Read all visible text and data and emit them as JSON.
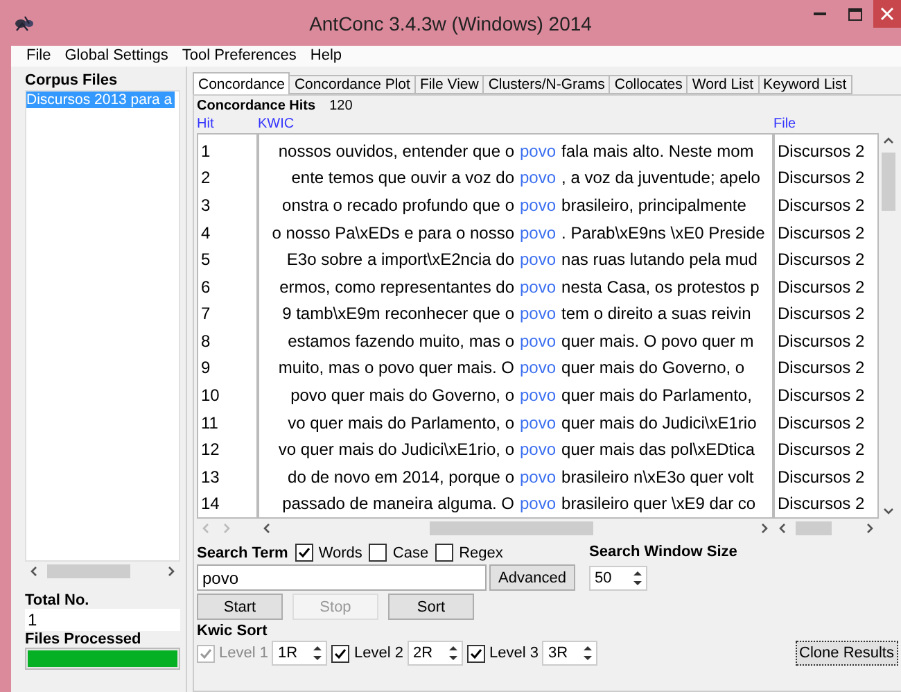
{
  "window": {
    "title": "AntConc 3.4.3w (Windows) 2014"
  },
  "menu": [
    "File",
    "Global Settings",
    "Tool Preferences",
    "Help"
  ],
  "corpus_files": {
    "title": "Corpus Files",
    "files": [
      {
        "name": "Discursos 2013 para a",
        "selected": true
      }
    ]
  },
  "total_no": {
    "label": "Total No.",
    "value": "1"
  },
  "files_processed": {
    "label": "Files Processed",
    "level": 1
  },
  "tabs": [
    {
      "label": "Concordance",
      "selected": true
    },
    {
      "label": "Concordance Plot",
      "selected": false
    },
    {
      "label": "File View",
      "selected": false
    },
    {
      "label": "Clusters/N-Grams",
      "selected": false
    },
    {
      "label": "Collocates",
      "selected": false
    },
    {
      "label": "Word List",
      "selected": false
    },
    {
      "label": "Keyword List",
      "selected": false
    }
  ],
  "concordance": {
    "hits_label": "Concordance Hits",
    "hits_count": "120",
    "columns": [
      "Hit",
      "KWIC",
      "File"
    ],
    "rows": [
      {
        "hit": "1",
        "left": "nossos ouvidos, entender que o",
        "keyword": "povo",
        "right": "fala mais alto. Neste mom",
        "file": "Discursos 2"
      },
      {
        "hit": "2",
        "left": "ente temos que ouvir a voz do",
        "keyword": "povo",
        "right": ", a voz da juventude; apelo",
        "file": "Discursos 2"
      },
      {
        "hit": "3",
        "left": "onstra o recado profundo que o",
        "keyword": "povo",
        "right": "brasileiro, principalmente",
        "file": "Discursos 2"
      },
      {
        "hit": "4",
        "left": "o nosso Pa\\xEDs e para o nosso",
        "keyword": "povo",
        "right": ". Parab\\xE9ns \\xE0 Preside",
        "file": "Discursos 2"
      },
      {
        "hit": "5",
        "left": "E3o sobre a import\\xE2ncia do",
        "keyword": "povo",
        "right": "nas ruas lutando pela mud",
        "file": "Discursos 2"
      },
      {
        "hit": "6",
        "left": "ermos, como representantes do",
        "keyword": "povo",
        "right": "nesta Casa, os protestos p",
        "file": "Discursos 2"
      },
      {
        "hit": "7",
        "left": "9 tamb\\xE9m reconhecer que o",
        "keyword": "povo",
        "right": "tem o direito a suas reivin",
        "file": "Discursos 2"
      },
      {
        "hit": "8",
        "left": "estamos fazendo muito, mas o",
        "keyword": "povo",
        "right": "quer mais. O povo quer m",
        "file": "Discursos 2"
      },
      {
        "hit": "9",
        "left": "muito, mas o povo quer mais. O",
        "keyword": "povo",
        "right": "quer mais do Governo, o",
        "file": "Discursos 2"
      },
      {
        "hit": "10",
        "left": "povo quer mais do Governo, o",
        "keyword": "povo",
        "right": "quer mais do Parlamento,",
        "file": "Discursos 2"
      },
      {
        "hit": "11",
        "left": "vo quer mais do Parlamento, o",
        "keyword": "povo",
        "right": "quer mais do Judici\\xE1rio",
        "file": "Discursos 2"
      },
      {
        "hit": "12",
        "left": "vo quer mais do Judici\\xE1rio, o",
        "keyword": "povo",
        "right": "quer mais das pol\\xEDtica",
        "file": "Discursos 2"
      },
      {
        "hit": "13",
        "left": "do de novo em 2014, porque o",
        "keyword": "povo",
        "right": "brasileiro n\\xE3o quer volt",
        "file": "Discursos 2"
      },
      {
        "hit": "14",
        "left": "passado de maneira alguma. O",
        "keyword": "povo",
        "right": "brasileiro quer \\xE9 dar co",
        "file": "Discursos 2"
      }
    ]
  },
  "search": {
    "label": "Search Term",
    "options": [
      {
        "label": "Words",
        "checked": true
      },
      {
        "label": "Case",
        "checked": false
      },
      {
        "label": "Regex",
        "checked": false
      }
    ],
    "value": "povo",
    "advanced": "Advanced"
  },
  "window_size": {
    "label": "Search Window Size",
    "value": "50"
  },
  "buttons": [
    {
      "label": "Start",
      "disabled": false
    },
    {
      "label": "Stop",
      "disabled": true
    },
    {
      "label": "Sort",
      "disabled": false
    }
  ],
  "kwic_sort": {
    "label": "Kwic Sort",
    "levels": [
      {
        "label": "Level 1",
        "checked": true,
        "disabled": true,
        "value": "1R"
      },
      {
        "label": "Level 2",
        "checked": true,
        "disabled": false,
        "value": "2R"
      },
      {
        "label": "Level 3",
        "checked": true,
        "disabled": false,
        "value": "3R"
      }
    ]
  },
  "clone_button": "Clone Results"
}
